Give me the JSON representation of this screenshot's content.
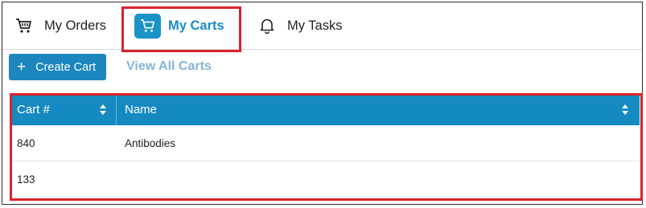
{
  "tabs": [
    {
      "label": "My Orders",
      "icon": "cart-icon",
      "selected": false
    },
    {
      "label": "My Carts",
      "icon": "cart-icon",
      "selected": true
    },
    {
      "label": "My Tasks",
      "icon": "bell-icon",
      "selected": false
    }
  ],
  "toolbar": {
    "create_label": "Create Cart",
    "create_icon": "plus-icon",
    "view_all_label": "View All Carts"
  },
  "table": {
    "columns": [
      "Cart #",
      "Name"
    ],
    "sort_icon": "sort-icon",
    "rows": [
      {
        "cart": "840",
        "name": "Antibodies"
      },
      {
        "cart": "133",
        "name": ""
      }
    ]
  },
  "colors": {
    "accent": "#1a8cc4",
    "header_bg": "#158ac1",
    "highlight": "#d9232d"
  }
}
